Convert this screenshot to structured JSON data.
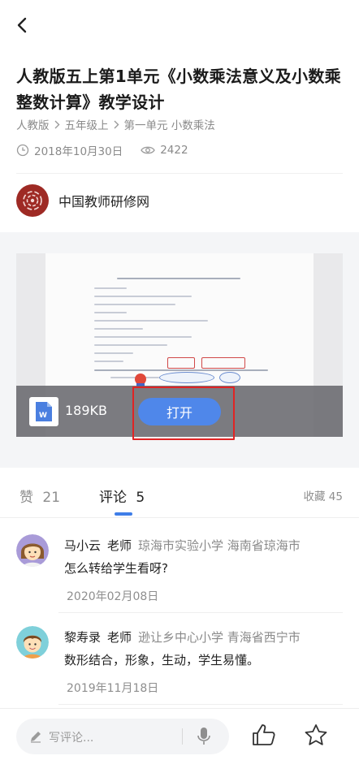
{
  "header": {
    "back_icon": "chevron-left-icon"
  },
  "article": {
    "title": "人教版五上第1单元《小数乘法意义及小数乘整数计算》教学设计",
    "breadcrumbs": [
      "人教版",
      "五年级上",
      "第一单元 小数乘法"
    ],
    "date": "2018年10月30日",
    "views": "2422"
  },
  "source": {
    "name": "中国教师研修网"
  },
  "file": {
    "size": "189KB",
    "open_label": "打开",
    "type_icon": "word-doc-icon"
  },
  "tabs": {
    "likes_label": "赞",
    "likes_count": "21",
    "comments_label": "评论",
    "comments_count": "5",
    "favorite": "收藏 45"
  },
  "comments": [
    {
      "name": "马小云",
      "role": "老师",
      "school": "琼海市实验小学 海南省琼海市",
      "text": "怎么转给学生看呀?",
      "date": "2020年02月08日"
    },
    {
      "name": "黎寿录",
      "role": "老师",
      "school": "逊让乡中心小学 青海省西宁市",
      "text": "数形结合，形象，生动，学生易懂。",
      "date": "2019年11月18日"
    }
  ],
  "bottom": {
    "placeholder": "写评论..."
  },
  "colors": {
    "accent": "#3f7ee8",
    "button": "#4f87ea",
    "highlight": "#e02424"
  }
}
